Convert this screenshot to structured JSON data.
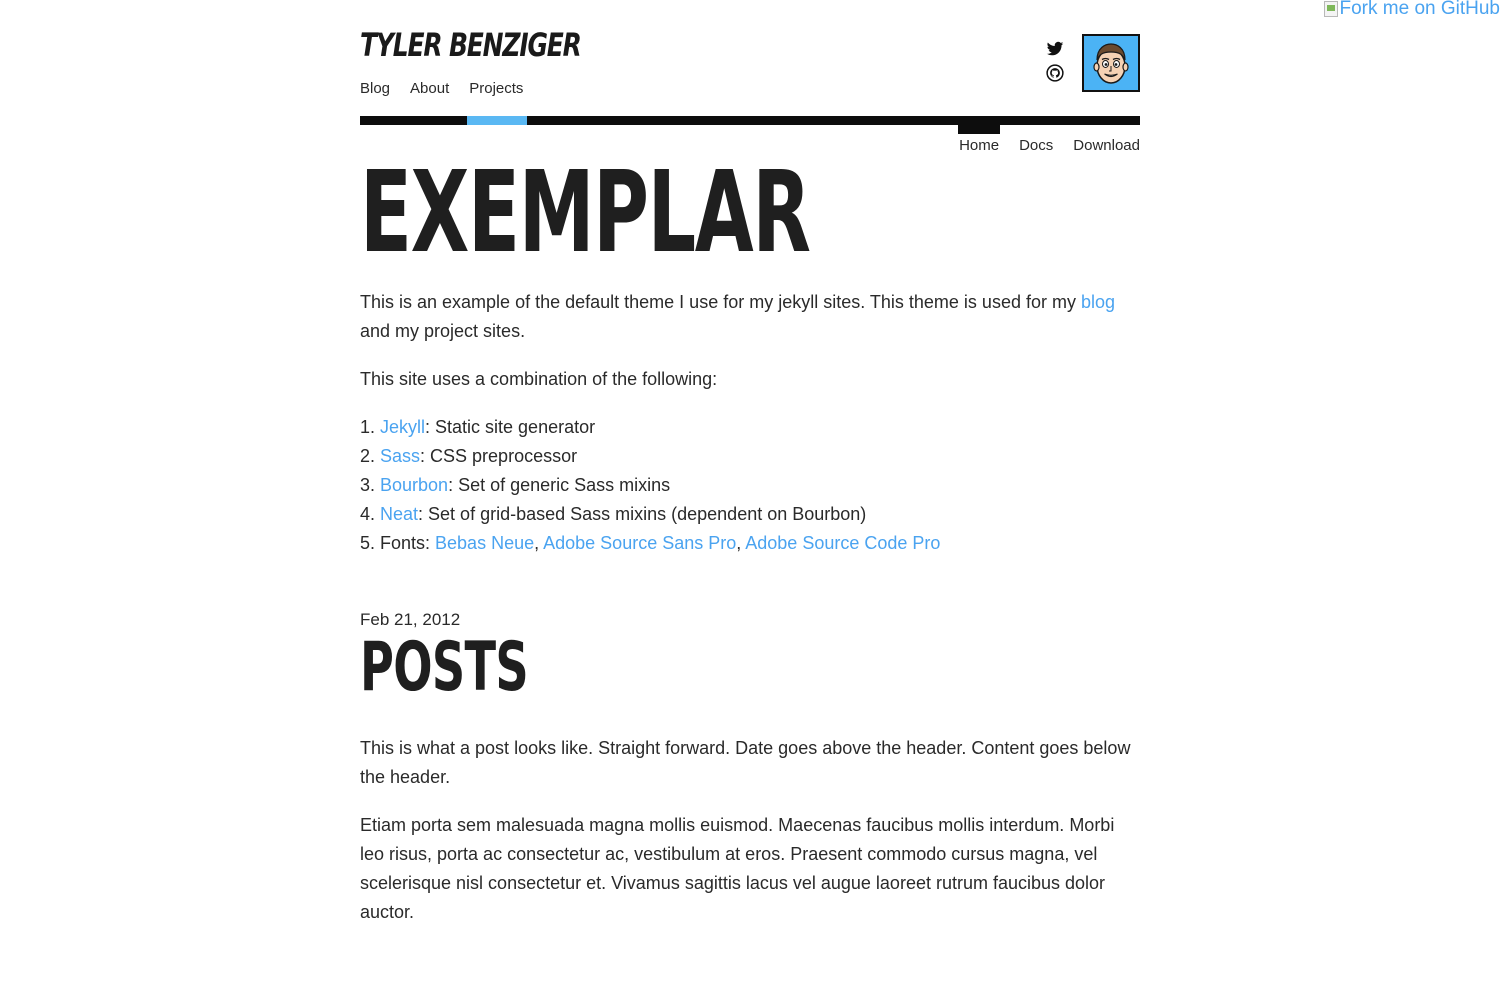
{
  "fork_ribbon": {
    "alt_text": "Fork me on GitHub"
  },
  "header": {
    "site_title": "TYLER BENZIGER",
    "nav": [
      {
        "label": "Blog"
      },
      {
        "label": "About"
      },
      {
        "label": "Projects"
      }
    ],
    "social_icons": [
      "twitter-icon",
      "github-icon"
    ]
  },
  "project_nav": {
    "items": [
      {
        "label": "Home",
        "active": true
      },
      {
        "label": "Docs"
      },
      {
        "label": "Download"
      }
    ]
  },
  "page": {
    "title": "EXEMPLAR",
    "intro": {
      "before": "This is an example of the default theme I use for my jekyll sites. This theme is used for my ",
      "link": "blog",
      "after": " and my project sites."
    },
    "uses_text": "This site uses a combination of the following:",
    "list": [
      {
        "link": "Jekyll",
        "text": ": Static site generator"
      },
      {
        "link": "Sass",
        "text": ": CSS preprocessor"
      },
      {
        "link": "Bourbon",
        "text": ": Set of generic Sass mixins"
      },
      {
        "link": "Neat",
        "text": ": Set of grid-based Sass mixins (dependent on Bourbon)"
      }
    ],
    "fonts": {
      "prefix": "Fonts: ",
      "links": [
        "Bebas Neue",
        "Adobe Source Sans Pro",
        "Adobe Source Code Pro"
      ],
      "sep": ", "
    }
  },
  "post": {
    "date": "Feb 21, 2012",
    "title": "POSTS",
    "paragraphs": [
      "This is what a post looks like. Straight forward. Date goes above the header. Content goes below the header.",
      "Etiam porta sem malesuada magna mollis euismod. Maecenas faucibus mollis interdum. Morbi leo risus, porta ac consectetur ac, vestibulum at eros. Praesent commodo cursus magna, vel scelerisque nisl consectetur et. Vivamus sagittis lacus vel augue laoreet rutrum faucibus dolor auctor."
    ]
  },
  "colors": {
    "link": "#4aa3f0",
    "accent_bar": "#5ab8f3",
    "text": "#2a2a2a",
    "heading": "#1f1f1f",
    "avatar_bg": "#4bb3f5"
  }
}
